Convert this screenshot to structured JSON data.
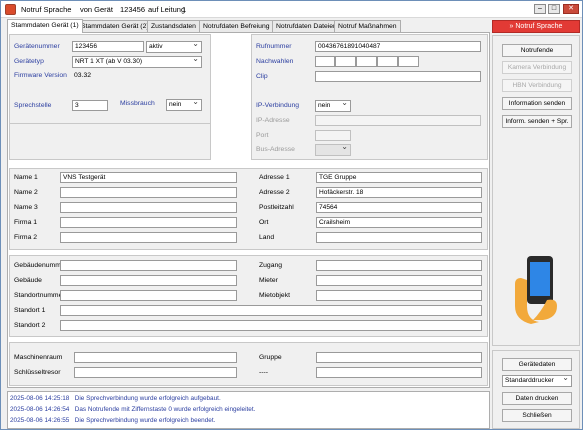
{
  "window": {
    "title": "Notruf Sprache",
    "device_prefix": "von Gerät",
    "device_id": "123456",
    "line_prefix": "auf Leitung",
    "line_id": "1"
  },
  "tabs": [
    {
      "label": "Stammdaten Gerät (1)"
    },
    {
      "label": "Stammdaten Gerät (2)"
    },
    {
      "label": "Zustandsdaten"
    },
    {
      "label": "Notrufdaten Befreiung"
    },
    {
      "label": "Notrufdaten Dateien"
    },
    {
      "label": "Notruf Maßnahmen"
    }
  ],
  "device": {
    "number_label": "Gerätenummer",
    "number_value": "123456",
    "status_value": "aktiv",
    "type_label": "Gerätetyp",
    "type_value": "NRT 1 XT (ab V 03.30)",
    "firmware_label": "Firmware Version",
    "firmware_value": "03.32",
    "speaker_label": "Sprechstelle",
    "speaker_value": "3",
    "abuse_label": "Missbrauch",
    "abuse_value": "nein"
  },
  "call": {
    "number_label": "Rufnummer",
    "number_value": "00436761891040487",
    "dial_label": "Nachwahlen",
    "clip_label": "Clip",
    "ip_label": "IP-Verbindung",
    "ip_value": "nein",
    "ip_addr_label": "IP-Adresse",
    "port_label": "Port",
    "bus_label": "Bus-Adresse"
  },
  "names": {
    "name1_label": "Name 1",
    "name1_value": "VNS Testgerät",
    "name2_label": "Name 2",
    "name3_label": "Name 3",
    "firma1_label": "Firma 1",
    "firma2_label": "Firma 2",
    "addr1_label": "Adresse 1",
    "addr1_value": "TGE Gruppe",
    "addr2_label": "Adresse 2",
    "addr2_value": "Hofäckerstr. 18",
    "zip_label": "Postleitzahl",
    "zip_value": "74564",
    "city_label": "Ort",
    "city_value": "Crailsheim",
    "country_label": "Land"
  },
  "location": {
    "building_no_label": "Gebäudenummer",
    "building_label": "Gebäude",
    "site_no_label": "Standortnummer",
    "site1_label": "Standort 1",
    "site2_label": "Standort 2",
    "access_label": "Zugang",
    "tenant_label": "Mieter",
    "rental_label": "Mietobjekt"
  },
  "extra": {
    "machine_label": "Maschinenraum",
    "keysafe_label": "Schlüsseltresor",
    "group_label": "Gruppe",
    "dash_label": "----"
  },
  "actions": {
    "notruf_sprache": "Notruf Sprache",
    "notrufende": "Notrufende",
    "kamera": "Kamera Verbindung",
    "hbn": "HBN Verbindung",
    "info_senden": "Information senden",
    "inform_spr": "Inform. senden + Spr.",
    "geraetedaten": "Gerätedaten",
    "drucker": "Standarddrucker",
    "daten_drucken": "Daten drucken",
    "schliessen": "Schließen"
  },
  "log": [
    {
      "date": "2025-08-06",
      "time": "14:25:18",
      "msg": "Die Sprechverbindung wurde erfolgreich aufgebaut."
    },
    {
      "date": "2025-08-06",
      "time": "14:26:54",
      "msg": "Das Notrufende mit Ziffernstaste 0 wurde erfolgreich eingeleitet."
    },
    {
      "date": "2025-08-06",
      "time": "14:26:55",
      "msg": "Die Sprechverbindung wurde erfolgreich beendet."
    }
  ],
  "colors": {
    "accent_red": "#e23a35",
    "label_blue": "#2b3ea0",
    "panel_bg": "#f0f0f0"
  }
}
